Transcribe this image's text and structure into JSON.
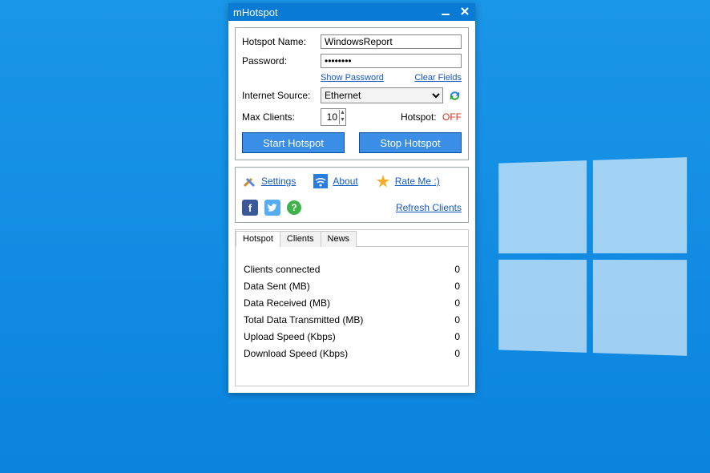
{
  "window": {
    "title": "mHotspot"
  },
  "form": {
    "hotspot_name_label": "Hotspot Name:",
    "hotspot_name_value": "WindowsReport",
    "password_label": "Password:",
    "password_value": "••••••••",
    "show_password": "Show Password",
    "clear_fields": "Clear Fields",
    "internet_source_label": "Internet Source:",
    "internet_source_value": "Ethernet",
    "max_clients_label": "Max Clients:",
    "max_clients_value": "10",
    "status_label": "Hotspot:",
    "status_value": "OFF",
    "start_btn": "Start Hotspot",
    "stop_btn": "Stop Hotspot"
  },
  "links": {
    "settings": "Settings",
    "about": "About",
    "rate": "Rate Me :)",
    "refresh_clients": "Refresh Clients"
  },
  "tabs": {
    "hotspot": "Hotspot",
    "clients": "Clients",
    "news": "News"
  },
  "stats": [
    {
      "label": "Clients connected",
      "value": "0"
    },
    {
      "label": "Data Sent (MB)",
      "value": "0"
    },
    {
      "label": "Data Received (MB)",
      "value": "0"
    },
    {
      "label": "Total Data Transmitted (MB)",
      "value": "0"
    },
    {
      "label": "Upload Speed (Kbps)",
      "value": "0"
    },
    {
      "label": "Download Speed (Kbps)",
      "value": "0"
    }
  ]
}
